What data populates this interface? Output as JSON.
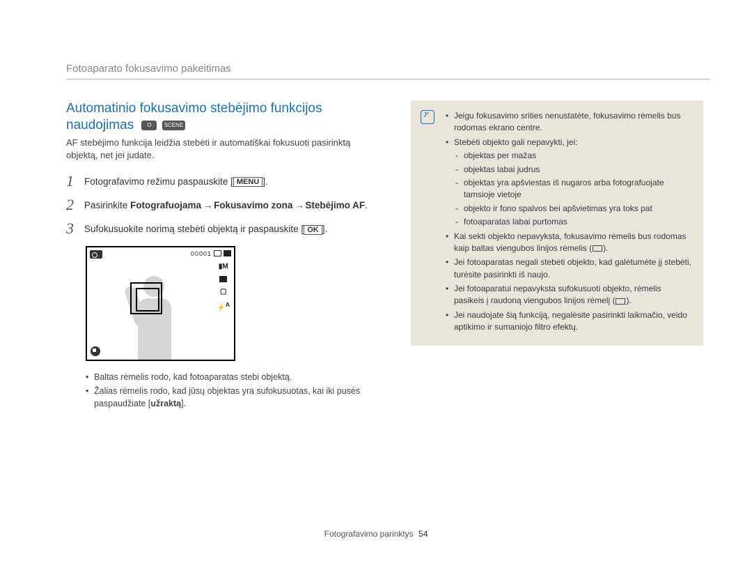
{
  "header": "Fotoaparato fokusavimo pakeitimas",
  "title_line1": "Automatinio fokusavimo stebėjimo funkcijos",
  "title_line2": "naudojimas",
  "mode_badge_1": "O",
  "mode_badge_2": "SCENE",
  "intro": "AF stebėjimo funkcija leidžia stebėti ir automatiškai fokusuoti pasirinktą objektą, net jei judate.",
  "steps": [
    {
      "n": "1",
      "pre": "Fotografavimo režimu paspauskite [",
      "btn": "MENU",
      "post": "]."
    },
    {
      "n": "2",
      "rich_a": "Pasirinkite ",
      "b1": "Fotografuojama",
      "arrow1": " → ",
      "b2": "Fokusavimo zona",
      "arrow2": " → ",
      "b3": "Stebėjimo AF",
      "post": "."
    },
    {
      "n": "3",
      "pre": "Sufokusuokite norimą stebėti objektą ir paspauskite [",
      "btn": "OK",
      "post": "]."
    }
  ],
  "camera": {
    "counter": "00001"
  },
  "sub_bullets": [
    "Baltas rėmelis rodo, kad fotoaparatas stebi objektą.",
    {
      "pre": "Žalias rėmelis rodo, kad jūsų objektas yra sufokusuotas, kai iki pusės paspaudžiate [",
      "b": "užraktą",
      "post": "]."
    }
  ],
  "notes": [
    "Jeigu fokusavimo srities nenustatėte, fokusavimo rėmelis bus rodomas ekrano centre.",
    {
      "text": "Stebėti objekto gali nepavykti, jei:",
      "sub": [
        "objektas per mažas",
        "objektas labai judrus",
        "objektas yra apšviestas iš nugaros arba fotografuojate tamsioje vietoje",
        "objekto ir fono spalvos bei apšvietimas yra toks pat",
        "fotoaparatas labai purtomas"
      ]
    },
    {
      "pre": "Kai sekti objekto nepavyksta, fokusavimo rėmelis bus rodomas kaip baltas viengubos linijos rėmelis (",
      "post": ")."
    },
    "Jei fotoaparatas negali stebėti objekto, kad galėtumėte jį stebėti, turėsite pasirinkti iš naujo.",
    {
      "pre": "Jei fotoaparatui nepavyksta sufokusuoti objekto, rėmelis pasikeis į raudoną viengubos linijos rėmelį (",
      "post": ")."
    },
    "Jei naudojate šią funkciją, negalėsite pasirinkti laikmačio, veido aptikimo ir sumaniojo filtro efektų."
  ],
  "footer": {
    "label": "Fotografavimo parinktys",
    "page": "54"
  }
}
